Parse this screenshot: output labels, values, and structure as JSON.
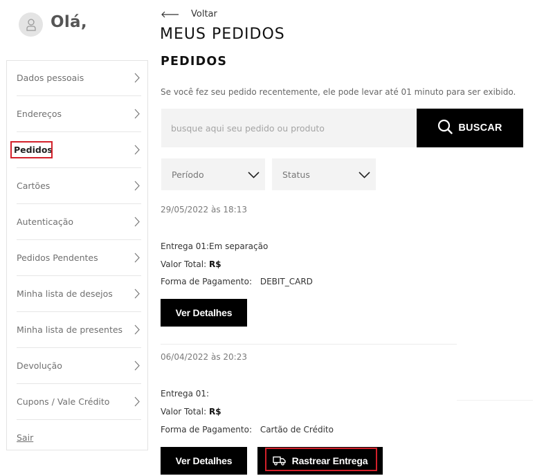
{
  "greeting": {
    "text": "Olá,"
  },
  "sidebar": {
    "items": [
      {
        "label": "Dados pessoais"
      },
      {
        "label": "Endereços"
      },
      {
        "label": "Pedidos"
      },
      {
        "label": "Cartões"
      },
      {
        "label": "Autenticação"
      },
      {
        "label": "Pedidos Pendentes"
      },
      {
        "label": "Minha lista de desejos"
      },
      {
        "label": "Minha lista de presentes"
      },
      {
        "label": "Devolução"
      },
      {
        "label": "Cupons / Vale Crédito"
      }
    ],
    "active_index": 2,
    "logout_label": "Sair"
  },
  "header": {
    "back_label": "Voltar",
    "title": "MEUS PEDIDOS",
    "section_title": "PEDIDOS",
    "notice": "Se você fez seu pedido recentemente, ele pode levar até 01 minuto para ser exibido."
  },
  "search": {
    "placeholder": "busque aqui seu pedido ou produto",
    "value": "",
    "button_label": "BUSCAR"
  },
  "filters": {
    "period_label": "Período",
    "status_label": "Status"
  },
  "orders": [
    {
      "date": "29/05/2022 às 18:13",
      "delivery": "Entrega 01:Em separação",
      "total_label": "Valor Total:",
      "total_value": "R$",
      "payment_label": "Forma de Pagamento:",
      "payment_value": "DEBIT_CARD",
      "details_label": "Ver Detalhes"
    },
    {
      "date": "06/04/2022 às 20:23",
      "delivery": "Entrega 01:",
      "total_label": "Valor Total:",
      "total_value": "R$",
      "payment_label": "Forma de Pagamento:",
      "payment_value": "Cartão de Crédito",
      "details_label": "Ver Detalhes",
      "track_label": "Rastrear Entrega"
    }
  ],
  "colors": {
    "highlight": "#d3202a",
    "button_bg": "#000000"
  }
}
